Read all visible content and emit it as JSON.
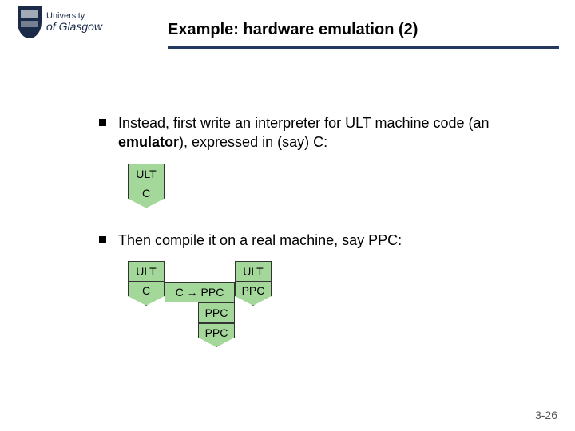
{
  "logo": {
    "top_line": "University",
    "bottom_line": "of Glasgow"
  },
  "title": "Example: hardware emulation (2)",
  "bullets": {
    "b1_pre": "Instead, first write an interpreter for ULT machine code (an ",
    "b1_bold": "emulator",
    "b1_post": "), expressed in (say) C:",
    "b2": "Then compile it on a real machine, say PPC:"
  },
  "diag1": {
    "top": "ULT",
    "bottom": "C"
  },
  "diag2": {
    "c1_top": "ULT",
    "c1_bot": "C",
    "c2": "C  →  PPC",
    "c3_top": "ULT",
    "c3_bot": "PPC",
    "c4": "PPC",
    "c5": "PPC"
  },
  "slide_number": "3-26"
}
